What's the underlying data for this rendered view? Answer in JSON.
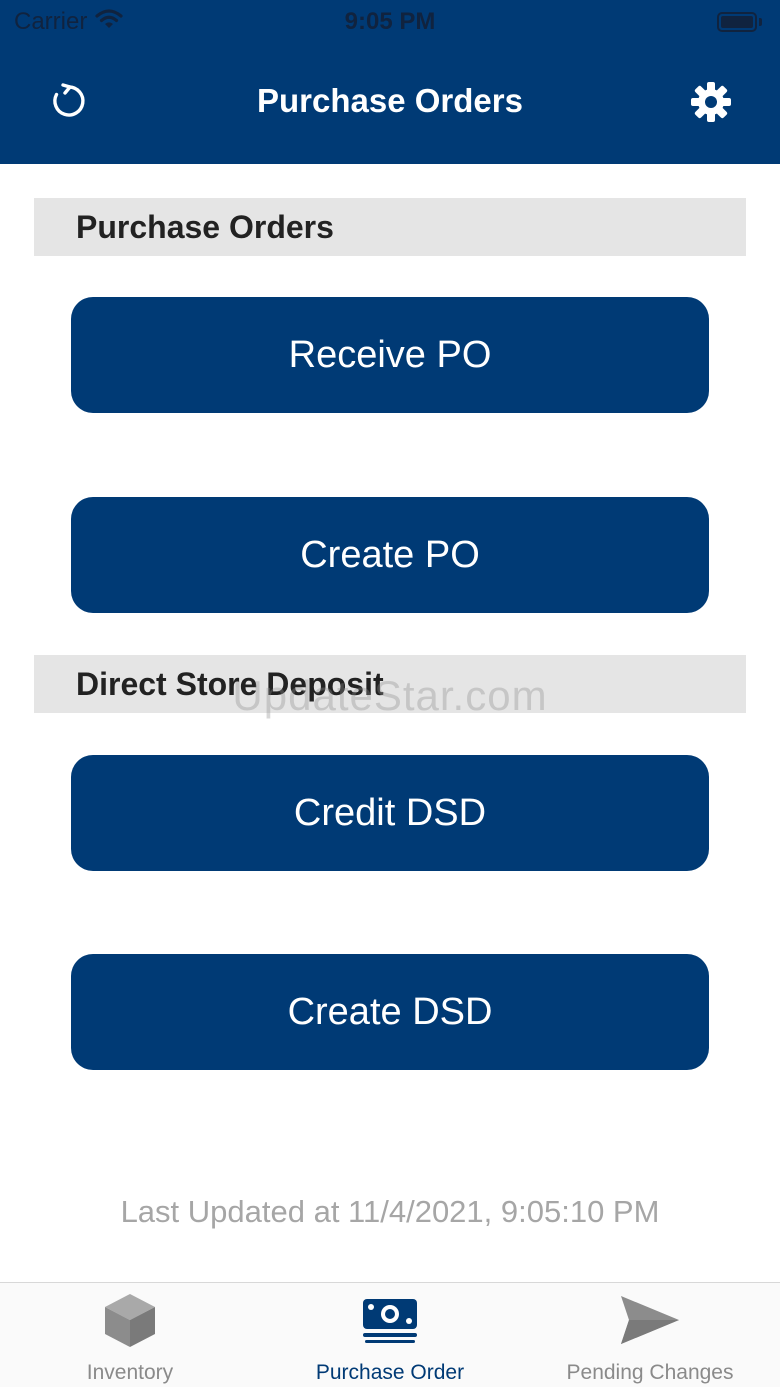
{
  "colors": {
    "brand": "#003A75",
    "tab_inactive": "#8a8a8a",
    "section_bg": "#e5e5e5"
  },
  "status_bar": {
    "carrier": "Carrier",
    "time": "9:05 PM"
  },
  "nav": {
    "title": "Purchase Orders",
    "left_icon": "refresh-icon",
    "right_icon": "gear-icon"
  },
  "sections": {
    "purchase_orders": {
      "title": "Purchase Orders",
      "buttons": [
        "Receive PO",
        "Create PO"
      ]
    },
    "direct_store_deposit": {
      "title": "Direct Store Deposit",
      "buttons": [
        "Credit DSD",
        "Create DSD"
      ]
    }
  },
  "watermark": "UpdateStar.com",
  "last_updated": "Last Updated at 11/4/2021, 9:05:10 PM",
  "tabs": [
    {
      "label": "Inventory",
      "icon": "box-icon",
      "active": false
    },
    {
      "label": "Purchase Order",
      "icon": "money-icon",
      "active": true
    },
    {
      "label": "Pending Changes",
      "icon": "send-icon",
      "active": false
    }
  ]
}
